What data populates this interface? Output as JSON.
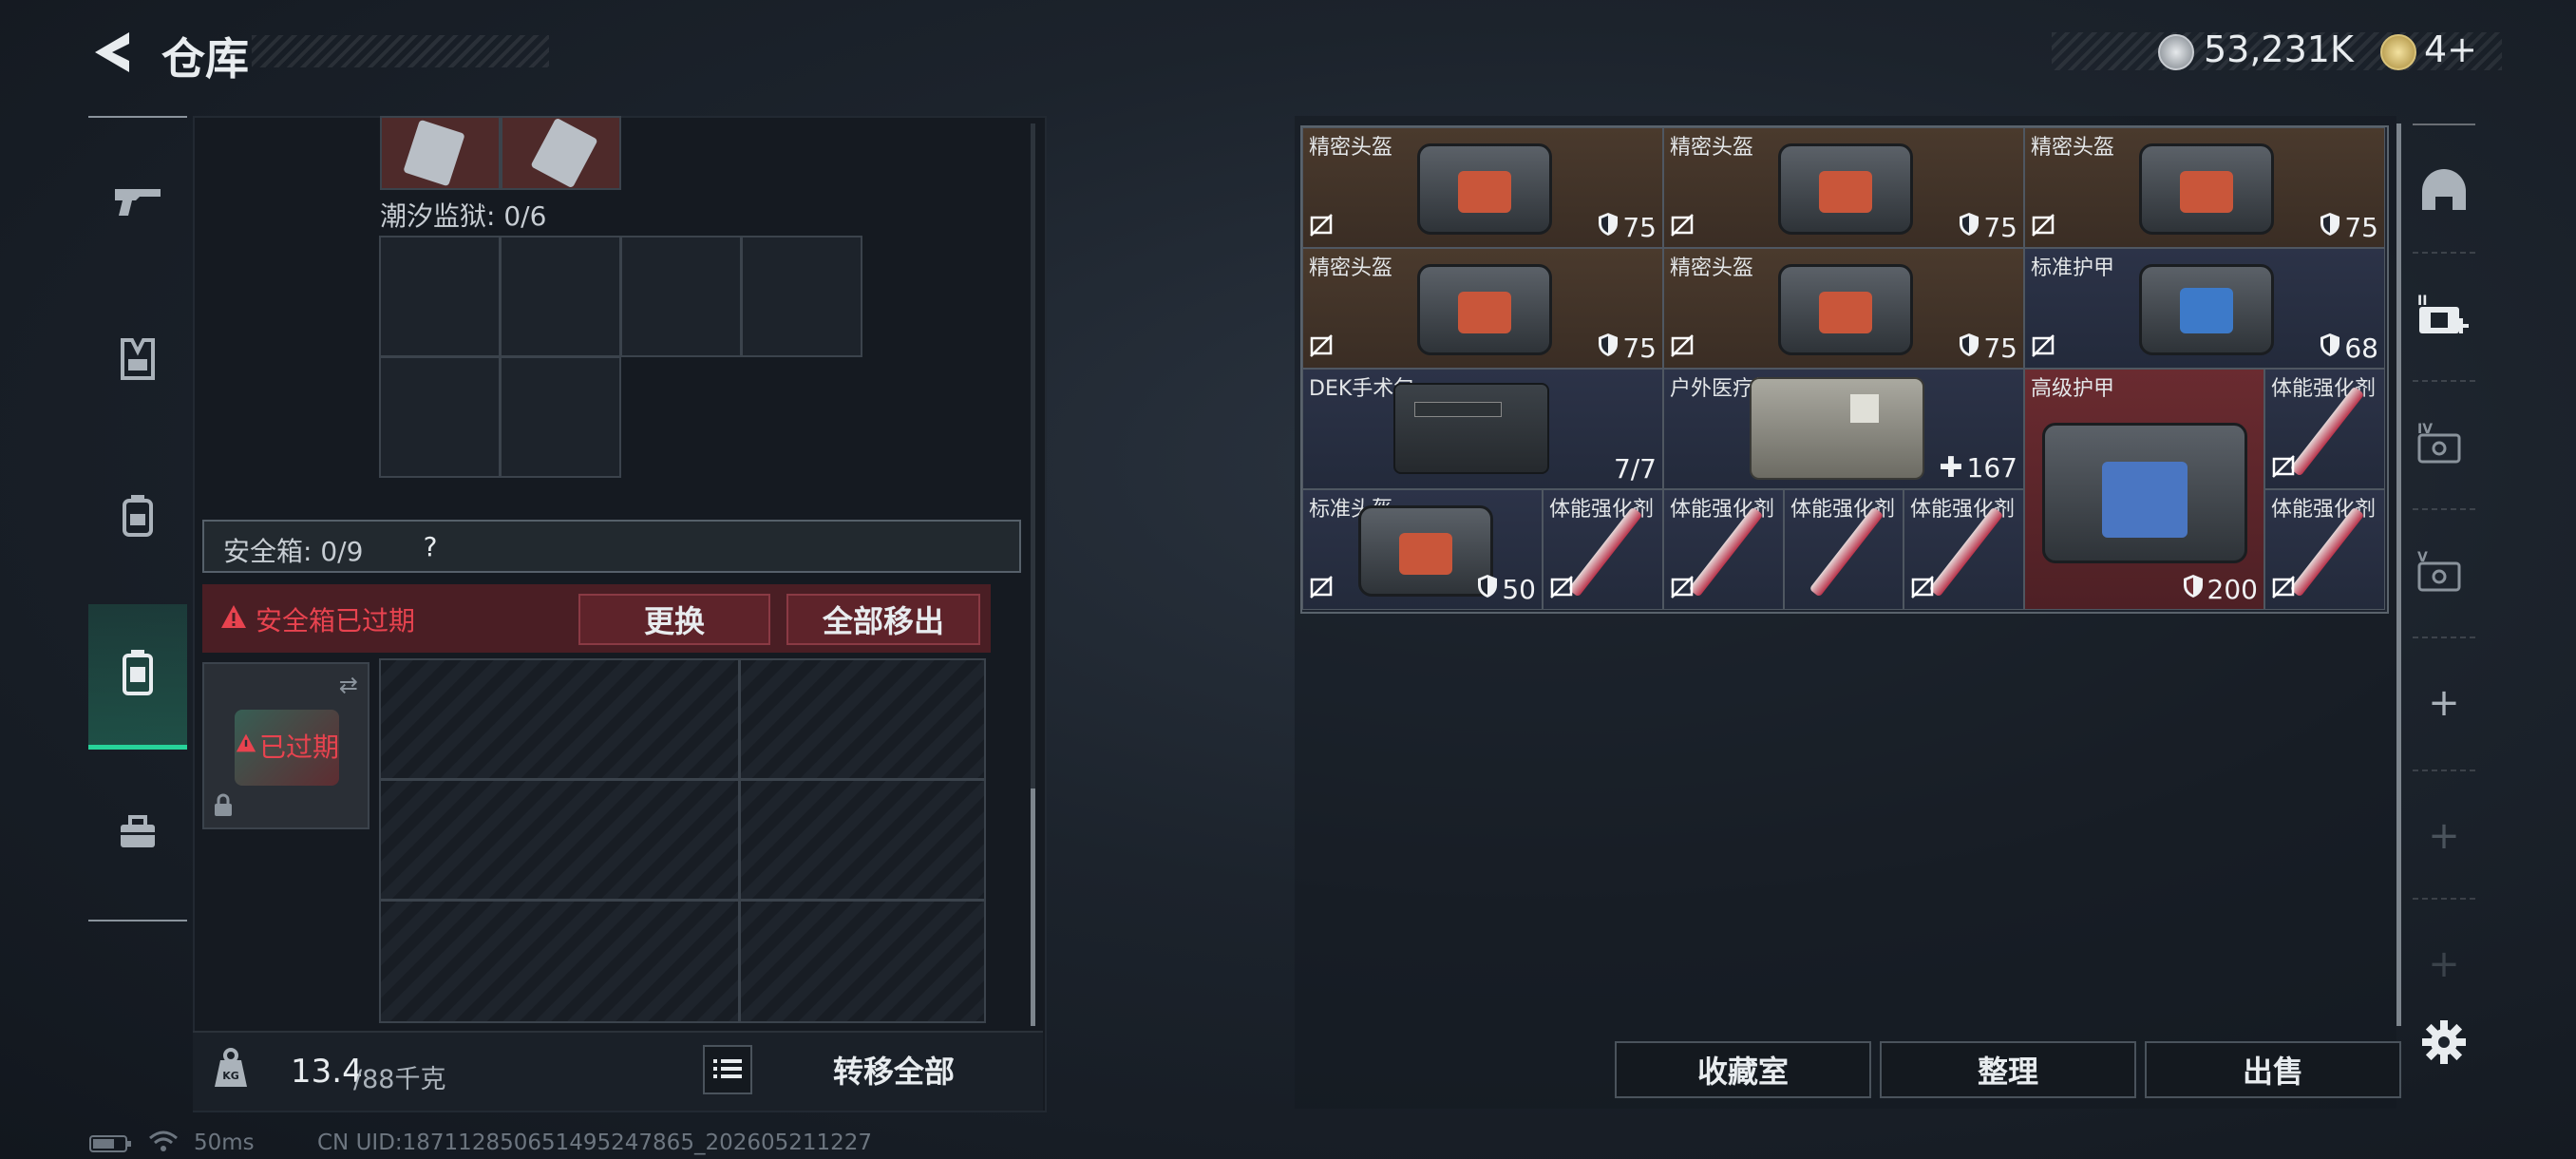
{
  "header": {
    "title": "仓库",
    "currency1": "53,231K",
    "currency2": "4+"
  },
  "left": {
    "container_label": "潮汐监狱: 0/6",
    "safe_box_label": "安全箱: 0/9",
    "safe_box_help": "?",
    "expired_warning": "安全箱已过期",
    "replace_button": "更换",
    "move_all_out_button": "全部移出",
    "expired_tag": "已过期",
    "weight_value": "13.4",
    "weight_max": "/88千克",
    "transfer_all_button": "转移全部"
  },
  "status": {
    "ping": "50ms",
    "uid": "CN UID:18711285065149524786​5_202605211227"
  },
  "right": {
    "items": [
      {
        "name": "精密头盔",
        "value": "75",
        "type": "helmet"
      },
      {
        "name": "精密头盔",
        "value": "75",
        "type": "helmet"
      },
      {
        "name": "精密头盔",
        "value": "75",
        "type": "helmet"
      },
      {
        "name": "精密头盔",
        "value": "75",
        "type": "helmet"
      },
      {
        "name": "精密头盔",
        "value": "75",
        "type": "helmet"
      },
      {
        "name": "标准护甲",
        "value": "68",
        "type": "armor"
      },
      {
        "name": "DEK手术包",
        "value": "7/7",
        "type": "surgery"
      },
      {
        "name": "户外医疗箱",
        "value": "167",
        "type": "medkit"
      },
      {
        "name": "高级护甲",
        "value": "200",
        "type": "armor-large"
      },
      {
        "name": "体能强化剂",
        "value": "",
        "type": "syringe"
      },
      {
        "name": "标准头盔",
        "value": "50",
        "type": "helmet"
      },
      {
        "name": "体能强化剂",
        "value": "",
        "type": "syringe"
      },
      {
        "name": "体能强化剂",
        "value": "",
        "type": "syringe"
      },
      {
        "name": "体能强化剂",
        "value": "",
        "type": "syringe"
      },
      {
        "name": "体能强化剂",
        "value": "",
        "type": "syringe"
      },
      {
        "name": "体能强化剂",
        "value": "",
        "type": "syringe"
      }
    ],
    "buttons": {
      "collection": "收藏室",
      "sort": "整理",
      "sell": "出售"
    }
  },
  "colors": {
    "accent_green": "#27d39a",
    "warning_red": "#e8434f",
    "brown_cell": "#4a3a2d",
    "blue_cell": "#2c3348",
    "red_cell": "#6a2b30"
  }
}
